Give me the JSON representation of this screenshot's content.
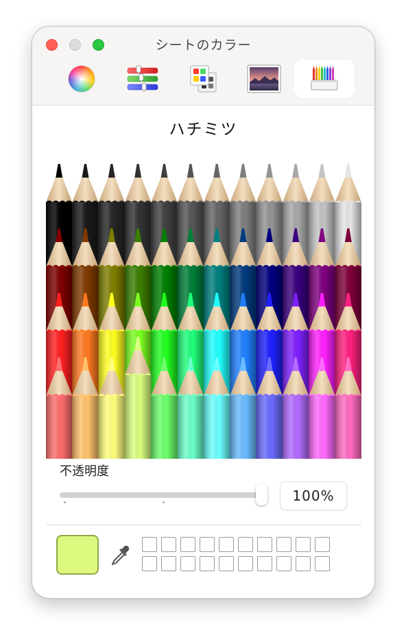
{
  "window": {
    "title": "シートのカラー"
  },
  "toolbar": {
    "tabs": [
      {
        "icon": "color-wheel-icon"
      },
      {
        "icon": "color-sliders-icon"
      },
      {
        "icon": "color-palettes-icon"
      },
      {
        "icon": "image-palettes-icon"
      },
      {
        "icon": "pencils-icon",
        "selected": true
      }
    ]
  },
  "pencils": {
    "selected_name": "ハチミツ",
    "rows": [
      [
        "#000000",
        "#191919",
        "#262626",
        "#333333",
        "#404040",
        "#555555",
        "#666666",
        "#7f7f7f",
        "#939393",
        "#a8a8a8",
        "#c3c3c3",
        "#e5e5e5"
      ],
      [
        "#7f0000",
        "#7f3a00",
        "#7f7f00",
        "#3a7f00",
        "#007f00",
        "#007f3a",
        "#007f7f",
        "#003a7f",
        "#00007f",
        "#3a007f",
        "#7f007f",
        "#7f003a"
      ],
      [
        "#ff2020",
        "#ff7a20",
        "#ffff20",
        "#7aff20",
        "#20ff20",
        "#20ff7a",
        "#20ffff",
        "#2080ff",
        "#2020ff",
        "#8020ff",
        "#ff20ff",
        "#ff2080"
      ],
      [
        "#ff6e6e",
        "#ffc26b",
        "#ffff7f",
        "#d9ff7f",
        "#6bff6b",
        "#6bffc8",
        "#6bffff",
        "#6bbcff",
        "#6b6bff",
        "#b36bff",
        "#ff6bff",
        "#ff6bc2"
      ]
    ],
    "selected_row": 3,
    "selected_col": 3
  },
  "opacity": {
    "label": "不透明度",
    "value": 100,
    "value_text": "100%"
  },
  "current_color": "#dcf87f",
  "eyedropper": {
    "icon": "eyedropper-icon"
  },
  "custom_swatches": {
    "rows": 2,
    "cols": 10
  }
}
